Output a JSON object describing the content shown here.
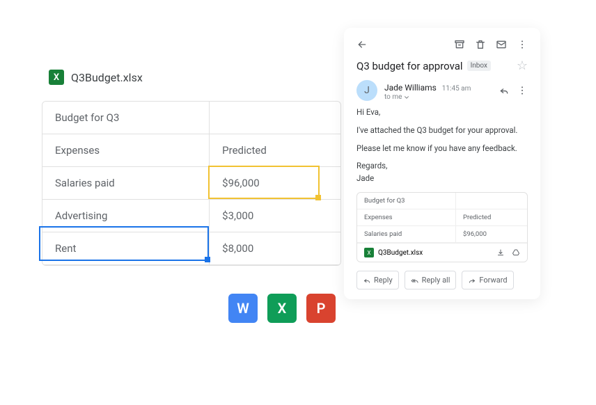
{
  "file": {
    "name": "Q3Budget.xlsx",
    "icon_letter": "X"
  },
  "sheet": {
    "rows": [
      [
        "Budget for Q3",
        ""
      ],
      [
        "Expenses",
        "Predicted"
      ],
      [
        "Salaries paid",
        "$96,000"
      ],
      [
        "Advertising",
        "$3,000"
      ],
      [
        "Rent",
        "$8,000"
      ]
    ]
  },
  "apps": {
    "word": "W",
    "excel": "X",
    "powerpoint": "P"
  },
  "email": {
    "subject": "Q3 budget for approval",
    "label": "Inbox",
    "sender_name": "Jade Williams",
    "sender_initial": "J",
    "sent_time": "11:45 am",
    "to_line": "to me",
    "body": {
      "greeting": "Hi Eva,",
      "p1": "I've attached the Q3 budget for your approval.",
      "p2": "Please let me know if you have any feedback.",
      "signoff": "Regards,",
      "signature": "Jade"
    },
    "attachment": {
      "preview_rows": [
        [
          "Budget for Q3",
          ""
        ],
        [
          "Expenses",
          "Predicted"
        ],
        [
          "Salaries paid",
          "$96,000"
        ]
      ],
      "filename": "Q3Budget.xlsx",
      "icon_letter": "X"
    },
    "actions": {
      "reply": "Reply",
      "reply_all": "Reply all",
      "forward": "Forward"
    }
  }
}
